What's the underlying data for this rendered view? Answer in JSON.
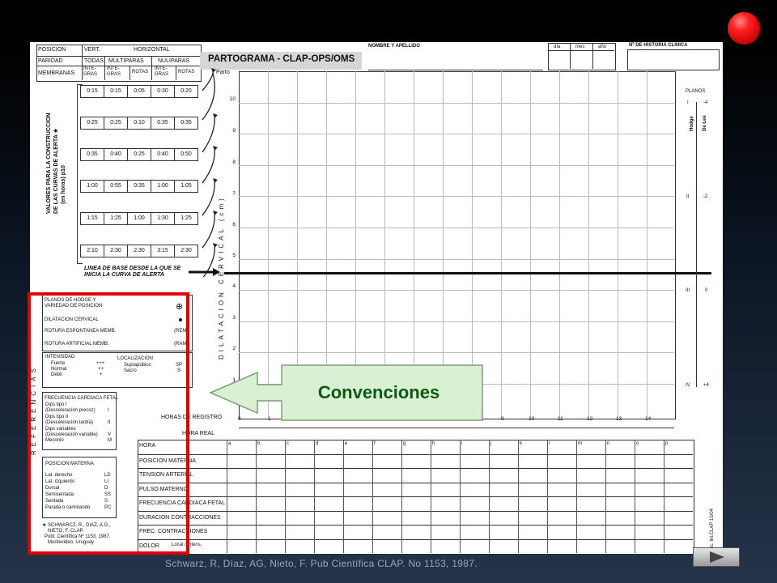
{
  "header": {
    "nombre_label": "NOMBRE Y APELLIDO",
    "dia": "día",
    "mes": "mes",
    "anio": "año",
    "historia": "Nº DE HISTORIA CLINICA",
    "title": "PARTOGRAMA  - CLAP-OPS/OMS"
  },
  "position_table": {
    "posicion": "POSICION",
    "vert": "VERT.",
    "horizontal": "HORIZONTAL",
    "paridad": "PARIDAD",
    "todas": "TODAS",
    "multiparas": "MULTIPARAS",
    "nuliparas": "NULIPARAS",
    "membranas": "MEMBRANAS",
    "cols": [
      "INTE-\nGRAS",
      "INTE-\nGRAS",
      "ROTAS",
      "INTE-\nGRAS",
      "ROTAS"
    ]
  },
  "alert_values": {
    "label_line1": "VALORES PARA LA CONSTRUCCION",
    "label_line2": "DE LAS CURVAS DE ALERTA ★",
    "label_line3": "(en horas) p10",
    "rows": [
      [
        "0:15",
        "0:15",
        "0:05",
        "0:30",
        "0:20"
      ],
      [
        "0:25",
        "0:25",
        "0:10",
        "0:35",
        "0:35"
      ],
      [
        "0:35",
        "0:40",
        "0:25",
        "0:40",
        "0:50"
      ],
      [
        "1:00",
        "0:55",
        "0:35",
        "1:00",
        "1:05"
      ],
      [
        "1:15",
        "1:25",
        "1:00",
        "1:30",
        "1:25"
      ],
      [
        "2:10",
        "2:30",
        "2:30",
        "3:15",
        "2:30"
      ]
    ]
  },
  "baseline_label": "LINEA DE BASE DESDE LA QUE SE\nINICIA LA CURVA DE ALERTA",
  "chart": {
    "parto": "Parto",
    "y_axis_label": "DILATACION  CERVICAL  (cm)",
    "y_ticks": [
      "10",
      "9",
      "8",
      "7",
      "6",
      "5",
      "4",
      "3",
      "2",
      "1"
    ],
    "x_ticks": [
      "0",
      "1",
      "9",
      "10",
      "11",
      "12",
      "13",
      "14"
    ],
    "horas_registro": "HORAS DE REGISTRO",
    "hora_real": "HORA REAL",
    "planos": "PLANOS",
    "hodge": "Hodge",
    "de_lee": "De Lee",
    "planes": [
      {
        "hodge": "I",
        "de_lee": "-4"
      },
      {
        "hodge": "II",
        "de_lee": "-2"
      },
      {
        "hodge": "III",
        "de_lee": "0"
      },
      {
        "hodge": "IV",
        "de_lee": "+4"
      }
    ]
  },
  "references": {
    "vertical_title": "REFERENCIAS",
    "items": [
      "PLANOS DE HODGE Y",
      "VARIEDAD DE POSICION",
      "DILATACION CERVICAL",
      "ROTURA ESPONTANEA MEMB.",
      "(REM)",
      "ROTURA ARTIFICIAL MEMB.",
      "(RAM)"
    ],
    "intensidad": "INTENSIDAD",
    "fuerte": "Fuerte",
    "fuerte_sym": "+++",
    "normal": "Normal",
    "normal_sym": "++",
    "debil": "Débil",
    "debil_sym": "+",
    "localizacion": "LOCALIZACION",
    "suprapubico": "Suprapúbico",
    "sp": "SP",
    "sacro": "Sacro",
    "s": "S",
    "fcf": "FRECUENCIA CARDIACA FETAL",
    "fcf_items": [
      [
        "Dips tipo I",
        ""
      ],
      [
        "(Desceleración precoz)",
        "I"
      ],
      [
        "Dips tipo II",
        ""
      ],
      [
        "(Desceleración tardía)",
        "II"
      ],
      [
        "Dips variables",
        ""
      ],
      [
        "(Desceleración variable)",
        "V"
      ],
      [
        "Meconio",
        "M"
      ]
    ],
    "posicion_materna": "POSICION MATERNA",
    "pm_items": [
      [
        "Lat. derecho",
        "LD"
      ],
      [
        "Lat. izquierdo",
        "LI"
      ],
      [
        "Dorsal",
        "D"
      ],
      [
        "Semisentada",
        "SS"
      ],
      [
        "Sentada",
        "S"
      ],
      [
        "Parada o caminando",
        "PC"
      ]
    ],
    "citation_lines": [
      "★ SCHWARCZ, R., DIAZ, A.G.,",
      "NIETO, F. CLAP",
      "Publ. Científica Nº 1153, 1987.",
      "Montevideo, Uruguay"
    ]
  },
  "bottom_table": {
    "rows": [
      "HORA",
      "POSICION MATERNA",
      "TENSION ARTERIAL",
      "PULSO MATERNO",
      "FRECUENCIA CARDIACA FETAL",
      "DURACION CONTRACCIONES",
      "FREC. CONTRACCIONES",
      "DOLOR"
    ],
    "dolor_options": "Local / Intens.",
    "letters": [
      "a",
      "b",
      "c",
      "d",
      "e",
      "f",
      "g",
      "h",
      "i",
      "j",
      "k",
      "l",
      "m",
      "n",
      "o",
      "p"
    ],
    "form_code": "Esc. Int.CLAP 10/04"
  },
  "callout": {
    "label": "Convenciones",
    "bg": "#d9f0d3",
    "border": "#7f9d7a"
  },
  "citation": "Schwarz, R, Díaz, AG, Nieto, F. Pub Científica CLAP.  No 1153, 1987.",
  "colors": {
    "highlight_box": "#e00000",
    "record_button": "#ee1111"
  },
  "nav": {
    "next_icon": "play-next-icon"
  }
}
